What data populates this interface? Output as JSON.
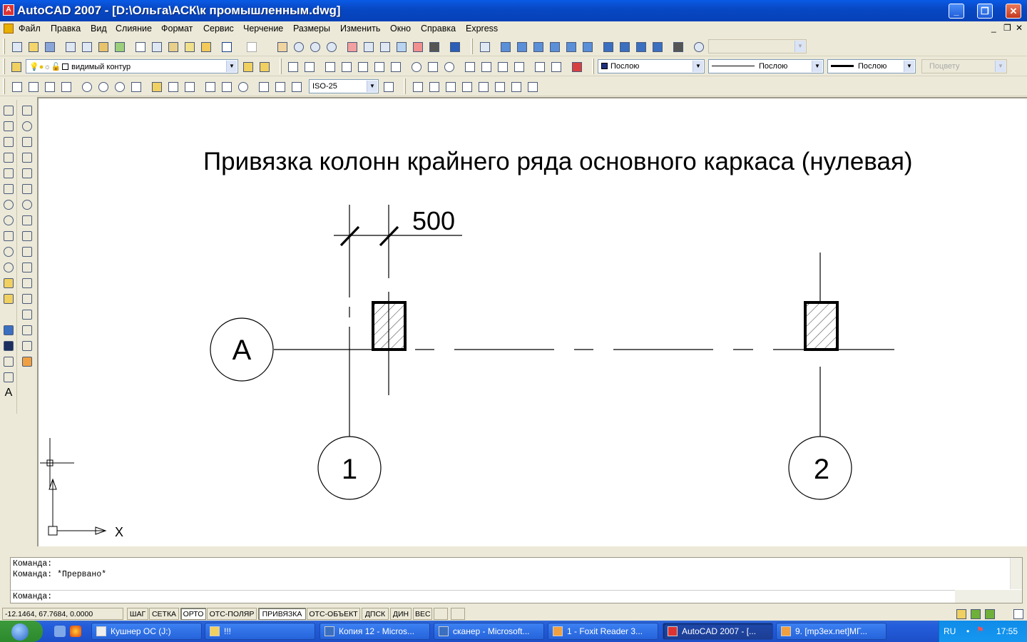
{
  "window": {
    "title": "AutoCAD 2007 - [D:\\Ольга\\АСК\\к промышленным.dwg]",
    "app_icon": "autocad-icon"
  },
  "menu": [
    "Файл",
    "Правка",
    "Вид",
    "Слияние",
    "Формат",
    "Сервис",
    "Черчение",
    "Размеры",
    "Изменить",
    "Окно",
    "Справка",
    "Express"
  ],
  "toolbar": {
    "layer_name": "видимый контур",
    "dimstyle": "ISO-25",
    "color": "Послою",
    "linetype": "Послою",
    "lineweight": "Послою",
    "plotstyle": "Поцвету"
  },
  "drawing": {
    "title": "Привязка колонн крайнего ряда основного каркаса (нулевая)",
    "dimension_text": "500",
    "axis_row_label": "А",
    "axis_col_labels": [
      "1",
      "2"
    ],
    "ucs_x_label": "X"
  },
  "command": {
    "history": [
      "Команда:",
      "Команда: *Прервано*"
    ],
    "prompt": "Команда:"
  },
  "status": {
    "coords": "-12.1464, 67.7684, 0.0000",
    "buttons": [
      "ШАГ",
      "СЕТКА",
      "ОРТО",
      "ОТС-ПОЛЯР",
      "ПРИВЯЗКА",
      "ОТС-ОБЪЕКТ",
      "ДПСК",
      "ДИН",
      "ВЕС"
    ]
  },
  "taskbar": {
    "tasks": [
      "Кушнер ОС (J:)",
      "!!!",
      "Копия 12 - Micros...",
      "сканер - Microsoft...",
      "1 - Foxit Reader 3...",
      "AutoCAD 2007 - [...",
      "9. [mp3ex.net]МГ..."
    ],
    "lang": "RU",
    "clock": "17:55"
  }
}
